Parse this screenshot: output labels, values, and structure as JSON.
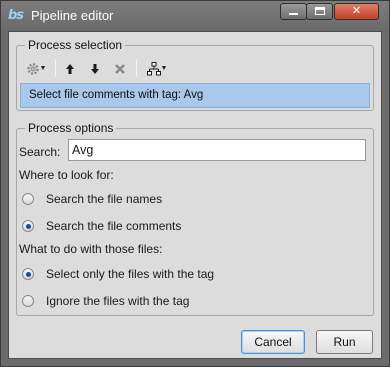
{
  "window": {
    "title": "Pipeline editor",
    "app_icon_text": "bs"
  },
  "process_selection": {
    "group_title": "Process selection",
    "toolbar": {
      "settings_icon": "gear-icon",
      "move_up_icon": "arrow-up-icon",
      "move_down_icon": "arrow-down-icon",
      "delete_icon": "x-icon",
      "tree_icon": "tree-icon"
    },
    "selected_item": "Select file comments with tag: Avg"
  },
  "process_options": {
    "group_title": "Process options",
    "search_label": "Search:",
    "search_value": "Avg",
    "where_label": "Where to look for:",
    "where_options": [
      {
        "label": "Search the file names",
        "checked": false
      },
      {
        "label": "Search the file comments",
        "checked": true
      }
    ],
    "what_label": "What to do with those files:",
    "what_options": [
      {
        "label": "Select only the files with the tag",
        "checked": true
      },
      {
        "label": "Ignore the files with the tag",
        "checked": false
      }
    ]
  },
  "buttons": {
    "cancel": "Cancel",
    "run": "Run"
  }
}
